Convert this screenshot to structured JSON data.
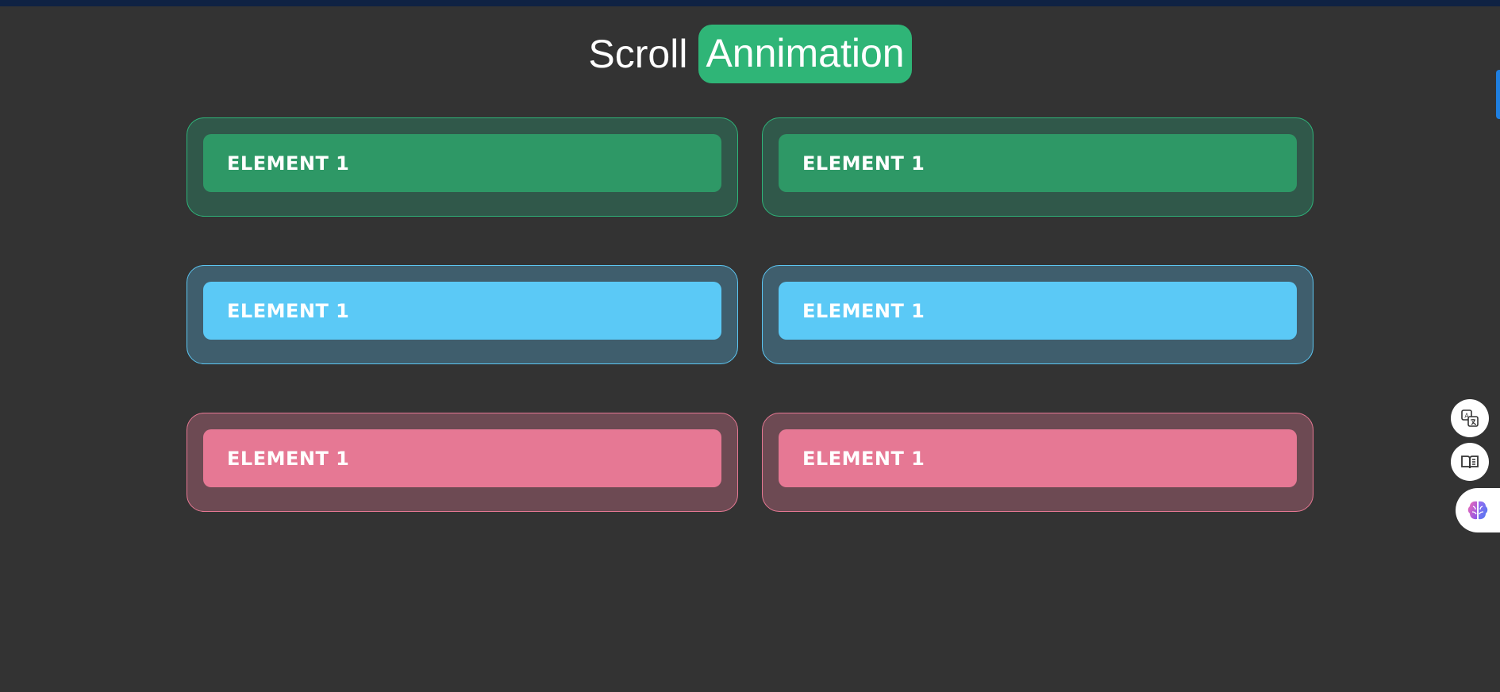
{
  "header": {
    "title_word": "Scroll",
    "title_highlight": "Annimation"
  },
  "cards": [
    {
      "label": "ELEMENT 1",
      "color": "green"
    },
    {
      "label": "ELEMENT 1",
      "color": "green"
    },
    {
      "label": "ELEMENT 1",
      "color": "blue"
    },
    {
      "label": "ELEMENT 1",
      "color": "blue"
    },
    {
      "label": "ELEMENT 1",
      "color": "pink"
    },
    {
      "label": "ELEMENT 1",
      "color": "pink"
    }
  ],
  "colors": {
    "background": "#333333",
    "green_accent": "#2fb577",
    "blue_accent": "#5bc9f6",
    "pink_accent": "#e67894"
  },
  "side_tools": [
    {
      "icon": "translate-icon"
    },
    {
      "icon": "book-reader-icon"
    },
    {
      "icon": "brain-icon"
    }
  ]
}
